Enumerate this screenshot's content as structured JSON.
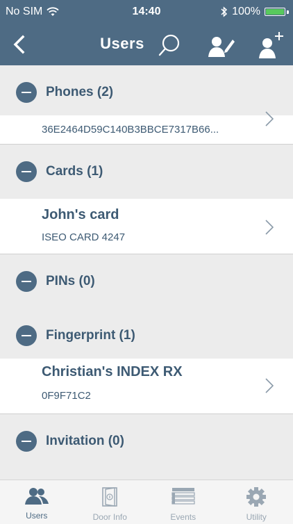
{
  "status_bar": {
    "carrier": "No SIM",
    "time": "14:40",
    "battery": "100%",
    "battery_level": 1.0
  },
  "nav": {
    "title": "Users",
    "icons": [
      "chevron-left-icon",
      "search-icon",
      "edit-user-icon",
      "add-user-icon"
    ]
  },
  "sections": {
    "phones": {
      "title": "Phones (2)",
      "item": {
        "subtitle": "36E2464D59C140B3BBCE7317B66..."
      }
    },
    "cards": {
      "title": "Cards (1)",
      "item": {
        "title": "John's card",
        "subtitle": "ISEO CARD 4247"
      }
    },
    "pins": {
      "title": "PINs (0)"
    },
    "fingerprint": {
      "title": "Fingerprint (1)",
      "item": {
        "title": "Christian's INDEX RX",
        "subtitle": "0F9F71C2"
      }
    },
    "invitation": {
      "title": "Invitation (0)"
    }
  },
  "tab_bar": {
    "users": "Users",
    "door_info": "Door Info",
    "events": "Events",
    "utility": "Utility",
    "active": "Users"
  },
  "colors": {
    "header": "#4e6b84",
    "accent_text": "#3d5a73",
    "background": "#ececec",
    "battery_fill": "#58c95d"
  }
}
